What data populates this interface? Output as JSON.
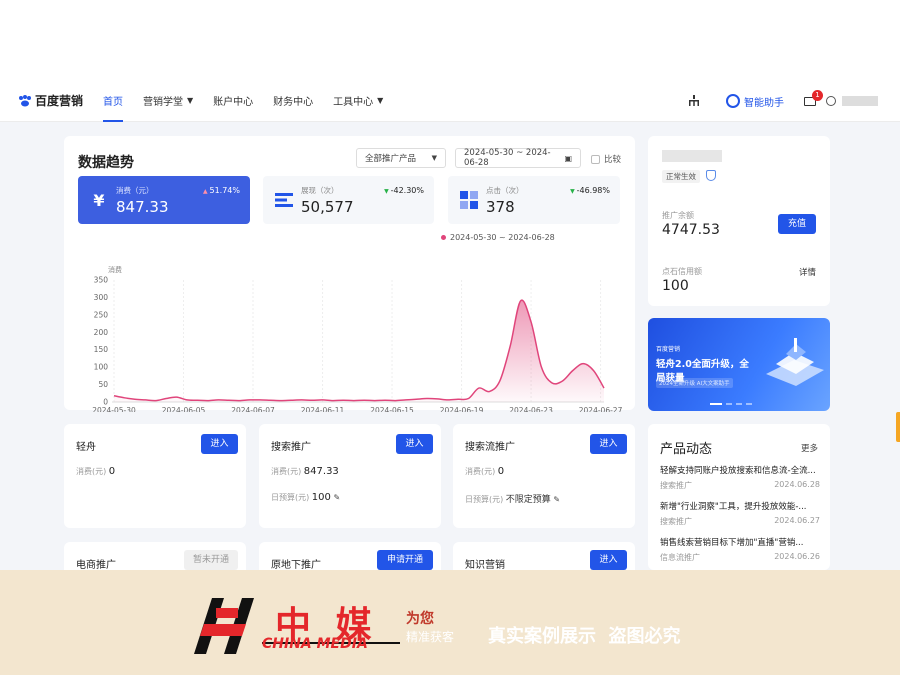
{
  "nav": {
    "logo": "百度营销",
    "items": [
      "首页",
      "营销学堂",
      "账户中心",
      "财务中心",
      "工具中心"
    ],
    "assistant": "智能助手",
    "mail_badge": "1"
  },
  "trend": {
    "title": "数据趋势",
    "product_select": "全部推广产品",
    "date_range": "2024-05-30 ~ 2024-06-28",
    "compare": "比较",
    "metrics": [
      {
        "label": "消费（元）",
        "value": "847.33",
        "change": "51.74%",
        "direction": "up"
      },
      {
        "label": "展现（次）",
        "value": "50,577",
        "change": "-42.30%",
        "direction": "down"
      },
      {
        "label": "点击（次）",
        "value": "378",
        "change": "-46.98%",
        "direction": "down"
      }
    ],
    "legend": "2024-05-30 ~ 2024-06-28"
  },
  "chart_data": {
    "type": "line",
    "ylabel": "消费",
    "ylim": [
      0,
      350
    ],
    "yticks": [
      0,
      50,
      100,
      150,
      200,
      250,
      300,
      350
    ],
    "xtick_labels": [
      "2024-05-30",
      "2024-06-05",
      "2024-06-07",
      "2024-06-11",
      "2024-06-15",
      "2024-06-19",
      "2024-06-23",
      "2024-06-27"
    ],
    "series": [
      {
        "values": [
          18,
          12,
          8,
          6,
          4,
          10,
          14,
          6,
          5,
          4,
          6,
          5,
          4,
          6,
          6,
          5,
          4,
          5,
          6,
          5,
          6,
          4,
          5,
          4,
          5,
          4,
          5,
          4,
          6,
          8,
          10,
          9,
          6,
          8,
          10,
          40,
          30,
          60,
          160,
          290,
          230,
          100,
          55,
          60,
          90,
          110,
          90,
          40
        ]
      }
    ],
    "color": "#e0457b"
  },
  "account": {
    "status": "正常生效",
    "balance_label": "推广余额",
    "balance_value": "4747.53",
    "recharge": "充值",
    "points_label": "点石信用额",
    "points_value": "100",
    "detail": "详情"
  },
  "products": [
    {
      "name": "轻舟",
      "button": "进入",
      "lines": [
        {
          "label": "消费(元)",
          "value": "0"
        }
      ]
    },
    {
      "name": "搜索推广",
      "button": "进入",
      "lines": [
        {
          "label": "消费(元)",
          "value": "847.33"
        },
        {
          "label": "日预算(元)",
          "value": "100"
        }
      ]
    },
    {
      "name": "搜索流推广",
      "button": "进入",
      "lines": [
        {
          "label": "消费(元)",
          "value": "0"
        },
        {
          "label": "日预算(元)",
          "value": "不限定预算"
        }
      ]
    }
  ],
  "row2": [
    {
      "name": "电商推广",
      "button": "暂未开通"
    },
    {
      "name": "原地下推广",
      "button": "申请开通"
    },
    {
      "name": "知识营销",
      "button": "进入"
    }
  ],
  "news": {
    "title": "产品动态",
    "more": "更多",
    "items": [
      {
        "text": "轻解支持同账户投放搜索和信息流-全流...",
        "tag": "搜索推广",
        "date": "2024.06.28"
      },
      {
        "text": "新增\"行业洞察\"工具，提升投放效能-...",
        "tag": "搜索推广",
        "date": "2024.06.27"
      },
      {
        "text": "销售线索营销目标下增加\"直播\"营销...",
        "tag": "信息流推广",
        "date": "2024.06.26"
      }
    ]
  },
  "banner": {
    "brand": "百度营销",
    "headline": "轻舟2.0全面升级，全局获量",
    "sub": "2024全新升级 AI大文案助手"
  },
  "watermark": {
    "brand_cn": "中 媒",
    "brand_en": "CHINA MEDIA",
    "tag1": "为您",
    "tag2": "精准获客",
    "slogan": "真实案例展示  盗图必究"
  }
}
